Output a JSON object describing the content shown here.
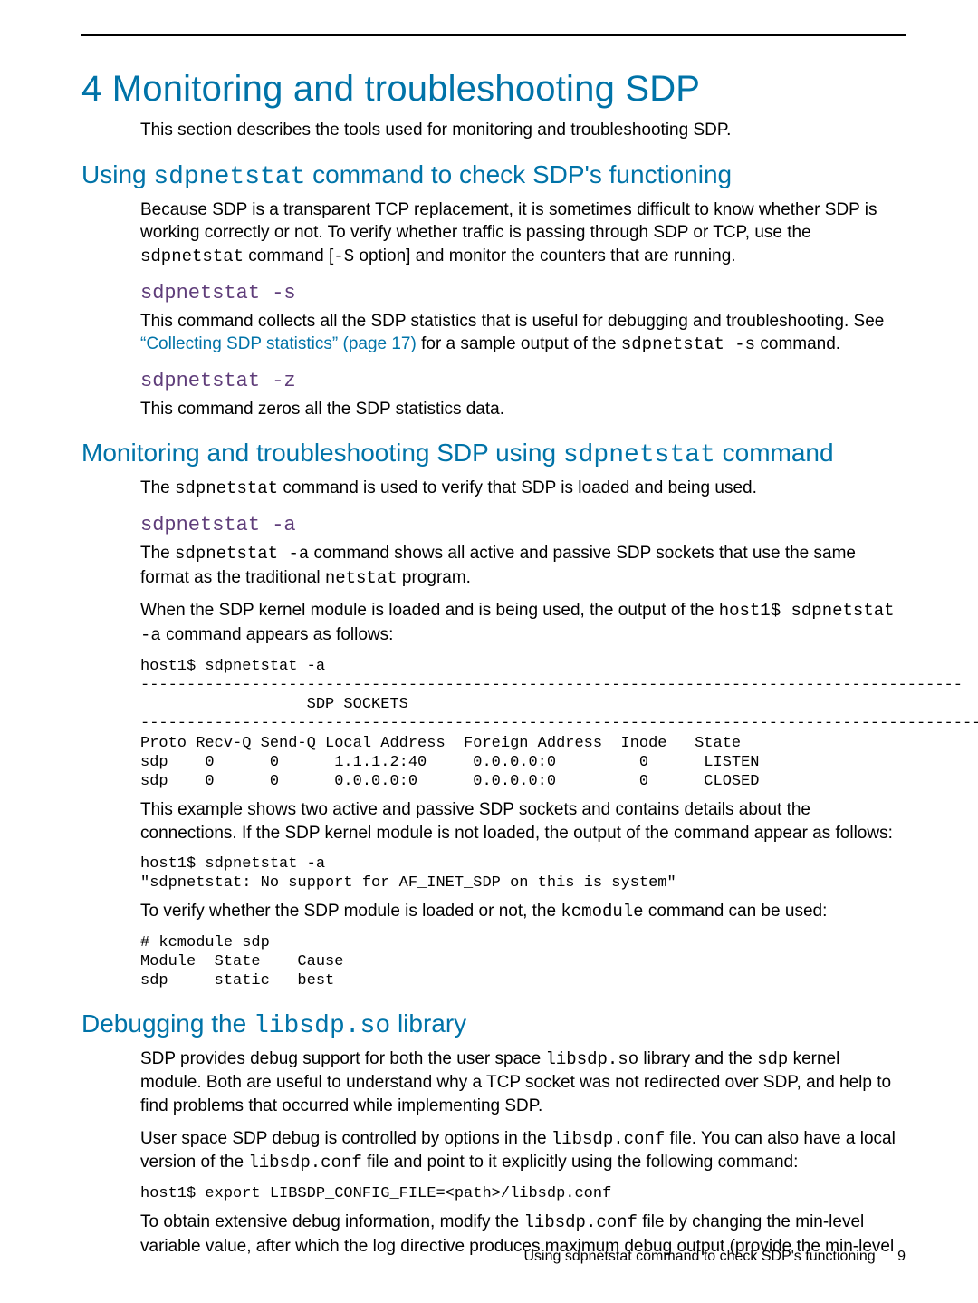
{
  "h1": "4 Monitoring and troubleshooting SDP",
  "intro": "This section describes the tools used for monitoring and troubleshooting SDP.",
  "sec_using": {
    "heading_pre": "Using ",
    "heading_cmd": "sdpnetstat",
    "heading_post": " command to check SDP's functioning",
    "p1a": "Because SDP is a transparent TCP replacement, it is sometimes difficult to know whether SDP is working correctly or not. To verify whether traffic is passing through SDP or TCP, use the ",
    "p1_cmd": "sdpnetstat",
    "p1b": " command [",
    "p1_opt": "-S",
    "p1c": " option] and monitor the counters that are running.",
    "sub_s": {
      "heading": "sdpnetstat -s",
      "p1": "This command collects all the SDP statistics that is useful for debugging and troubleshooting. See ",
      "link": "“Collecting SDP statistics” (page 17)",
      "p2a": " for a sample output of the ",
      "p2_cmd": "sdpnetstat -s",
      "p2b": " command."
    },
    "sub_z": {
      "heading": "sdpnetstat -z",
      "p1": "This command zeros all the SDP statistics data."
    }
  },
  "sec_monitor": {
    "heading_pre": "Monitoring and troubleshooting SDP using ",
    "heading_cmd": "sdpnetstat",
    "heading_post": " command",
    "p1a": "The ",
    "p1_cmd": "sdpnetstat",
    "p1b": " command is used to verify that SDP is loaded and being used.",
    "sub_a": {
      "heading": "sdpnetstat -a",
      "p1a": "The ",
      "p1_cmd": "sdpnetstat -a",
      "p1b": " command shows all active and passive SDP sockets that use the same format as the traditional ",
      "p1_cmd2": "netstat",
      "p1c": " program.",
      "p2a": "When the SDP kernel module is loaded and is being used, the output of the ",
      "p2_cmd": "host1$ sdpnetstat -a",
      "p2b": " command appears as follows:",
      "code1": "host1$ sdpnetstat -a\n-----------------------------------------------------------------------------------------\n                  SDP SOCKETS\n------------------------------------------------------------------------------------------------\nProto Recv-Q Send-Q Local Address  Foreign Address  Inode   State\nsdp    0      0      1.1.1.2:40     0.0.0.0:0         0      LISTEN\nsdp    0      0      0.0.0.0:0      0.0.0.0:0         0      CLOSED",
      "p3": "This example shows two active and passive SDP sockets and contains details about the connections. If the SDP kernel module is not loaded, the output of the command appear as follows:",
      "code2": "host1$ sdpnetstat -a\n\"sdpnetstat: No support for AF_INET_SDP on this is system\"",
      "p4a": "To verify whether the SDP module is loaded or not, the ",
      "p4_cmd": "kcmodule",
      "p4b": " command can be used:",
      "code3": "# kcmodule sdp\nModule  State    Cause\nsdp     static   best"
    }
  },
  "sec_debug": {
    "heading_pre": "Debugging the ",
    "heading_cmd": "libsdp.so",
    "heading_post": " library",
    "p1a": "SDP provides debug support for both the user space ",
    "p1_cmd1": "libsdp.so",
    "p1b": " library and the ",
    "p1_cmd2": "sdp",
    "p1c": " kernel module. Both are useful to understand why a TCP socket was not redirected over SDP, and help to find problems that occurred while implementing SDP.",
    "p2a": "User space SDP debug is controlled by options in the ",
    "p2_cmd1": "libsdp.conf",
    "p2b": " file. You can also have a local version of the ",
    "p2_cmd2": "libsdp.conf",
    "p2c": " file and point to it explicitly using the following command:",
    "code1": "host1$ export LIBSDP_CONFIG_FILE=<path>/libsdp.conf",
    "p3a": "To obtain extensive debug information, modify the ",
    "p3_cmd": "libsdp.conf",
    "p3b": " file by changing the min-level variable value, after which the log directive produces maximum debug output (provide the min-level"
  },
  "footer": {
    "text": "Using sdpnetstat command to check SDP's functioning",
    "page": "9"
  }
}
